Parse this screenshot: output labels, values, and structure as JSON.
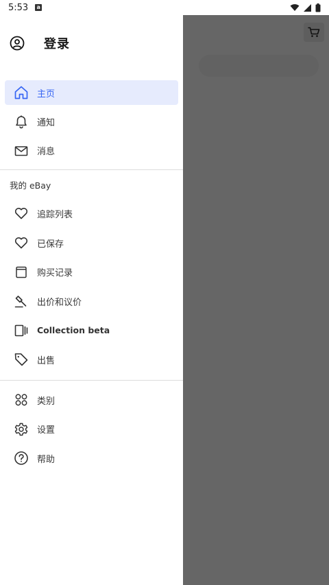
{
  "status_bar": {
    "time": "5:53",
    "notification_icon": "app-notification-icon",
    "icons": [
      "wifi-icon",
      "signal-icon",
      "battery-icon"
    ]
  },
  "drawer": {
    "header": {
      "login_label": "登录",
      "icon": "account-circle-icon"
    },
    "primary_items": [
      {
        "label": "主页",
        "icon": "home-icon",
        "active": true
      },
      {
        "label": "通知",
        "icon": "bell-icon",
        "active": false
      },
      {
        "label": "消息",
        "icon": "mail-icon",
        "active": false
      }
    ],
    "my_ebay": {
      "title": "我的 eBay",
      "items": [
        {
          "label": "追踪列表",
          "icon": "heart-icon"
        },
        {
          "label": "已保存",
          "icon": "heart-icon"
        },
        {
          "label": "购买记录",
          "icon": "purchase-history-icon"
        },
        {
          "label": "出价和议价",
          "icon": "gavel-icon"
        },
        {
          "label": "Collection beta",
          "icon": "collection-icon"
        },
        {
          "label": "出售",
          "icon": "tag-icon"
        }
      ]
    },
    "other_items": [
      {
        "label": "类别",
        "icon": "categories-icon"
      },
      {
        "label": "设置",
        "icon": "gear-icon"
      },
      {
        "label": "帮助",
        "icon": "help-icon"
      }
    ]
  },
  "background": {
    "cart_icon": "cart-icon"
  },
  "colors": {
    "accent": "#3665f3",
    "active_bg": "#e6ebfd",
    "scrim": "#666666"
  }
}
